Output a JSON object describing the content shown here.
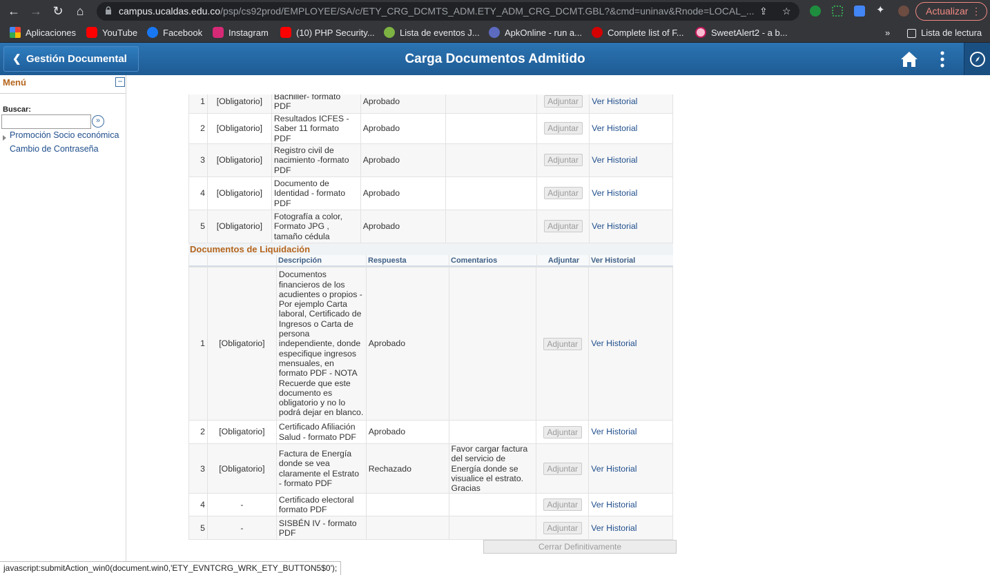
{
  "browser": {
    "url_host": "campus.ucaldas.edu.co",
    "url_path": "/psp/cs92prod/EMPLOYEE/SA/c/ETY_CRG_DCMTS_ADM.ETY_ADM_CRG_DCMT.GBL?&cmd=uninav&Rnode=LOCAL_...",
    "update_label": "Actualizar",
    "bookmarks": [
      {
        "label": "Aplicaciones",
        "icon": "apps-grid-icon",
        "color": "#e94235"
      },
      {
        "label": "YouTube",
        "icon": "youtube-icon",
        "color": "#ff0000"
      },
      {
        "label": "Facebook",
        "icon": "facebook-icon",
        "color": "#1877f2"
      },
      {
        "label": "Instagram",
        "icon": "instagram-icon",
        "color": "#d62976"
      },
      {
        "label": "(10) PHP Security...",
        "icon": "youtube-icon",
        "color": "#ff0000"
      },
      {
        "label": "Lista de eventos J...",
        "icon": "leaf-icon",
        "color": "#7cb342"
      },
      {
        "label": "ApkOnline - run a...",
        "icon": "apkonline-icon",
        "color": "#5c6bc0"
      },
      {
        "label": "Complete list of F...",
        "icon": "red-dot-icon",
        "color": "#d50000"
      },
      {
        "label": "SweetAlert2 - a b...",
        "icon": "sweetalert-icon",
        "color": "#f8bbd0"
      }
    ],
    "more_label": "»",
    "reading_list_label": "Lista de lectura"
  },
  "header": {
    "back_label": "Gestión Documental",
    "title": "Carga Documentos Admitido"
  },
  "menu": {
    "title": "Menú",
    "collapse_symbol": "−",
    "search_label": "Buscar:",
    "search_value": "",
    "go_symbol": "»",
    "items": [
      {
        "label": "Promoción Socio económica"
      },
      {
        "label": "Cambio de Contraseña"
      }
    ]
  },
  "academic_docs": {
    "rows": [
      {
        "num": "1",
        "req": "[Obligatorio]",
        "desc": "Bachiller-  formato PDF",
        "resp": "Aprobado",
        "comment": "",
        "adjuntar": "Adjuntar",
        "historial": "Ver Historial"
      },
      {
        "num": "2",
        "req": "[Obligatorio]",
        "desc": "Resultados ICFES - Saber 11 formato  PDF",
        "resp": "Aprobado",
        "comment": "",
        "adjuntar": "Adjuntar",
        "historial": "Ver Historial"
      },
      {
        "num": "3",
        "req": "[Obligatorio]",
        "desc": "Registro civil de nacimiento -formato PDF",
        "resp": "Aprobado",
        "comment": "",
        "adjuntar": "Adjuntar",
        "historial": "Ver Historial"
      },
      {
        "num": "4",
        "req": "[Obligatorio]",
        "desc": "Documento de Identidad - formato PDF",
        "resp": "Aprobado",
        "comment": "",
        "adjuntar": "Adjuntar",
        "historial": "Ver Historial"
      },
      {
        "num": "5",
        "req": "[Obligatorio]",
        "desc": "Fotografía a color, Formato JPG , tamaño cédula",
        "resp": "Aprobado",
        "comment": "",
        "adjuntar": "Adjuntar",
        "historial": "Ver Historial"
      }
    ]
  },
  "liquidacion": {
    "title": "Documentos de Liquidación",
    "headers": {
      "desc": "Descripción",
      "resp": "Respuesta",
      "comment": "Comentarios",
      "adjuntar": "Adjuntar",
      "historial": "Ver Historial"
    },
    "rows": [
      {
        "num": "1",
        "req": "[Obligatorio]",
        "desc": "Documentos financieros de los acudientes o propios - Por ejemplo Carta laboral, Certificado de Ingresos o Carta de persona independiente, donde especifique ingresos mensuales, en formato  PDF - NOTA  Recuerde que este documento es obligatorio y no lo podrá dejar en blanco.",
        "resp": "Aprobado",
        "comment": "",
        "adjuntar": "Adjuntar",
        "historial": "Ver Historial"
      },
      {
        "num": "2",
        "req": "[Obligatorio]",
        "desc": "Certificado Afiliación Salud - formato  PDF",
        "resp": "Aprobado",
        "comment": "",
        "adjuntar": "Adjuntar",
        "historial": "Ver Historial"
      },
      {
        "num": "3",
        "req": "[Obligatorio]",
        "desc": "Factura de Energía donde se vea claramente el Estrato - formato  PDF",
        "resp": "Rechazado",
        "comment": "Favor cargar factura del servicio de Energía donde se visualice el estrato. Gracias",
        "adjuntar": "Adjuntar",
        "historial": "Ver Historial"
      },
      {
        "num": "4",
        "req": "-",
        "desc": "Certificado electoral formato  PDF",
        "resp": "",
        "comment": "",
        "adjuntar": "Adjuntar",
        "historial": "Ver Historial"
      },
      {
        "num": "5",
        "req": "-",
        "desc": "SISBÉN IV -  formato PDF",
        "resp": "",
        "comment": "",
        "adjuntar": "Adjuntar",
        "historial": "Ver Historial"
      }
    ]
  },
  "close_button_label": "Cerrar Definitivamente",
  "status_bar_text": "javascript:submitAction_win0(document.win0,'ETY_EVNTCRG_WRK_ETY_BUTTON5$0');"
}
